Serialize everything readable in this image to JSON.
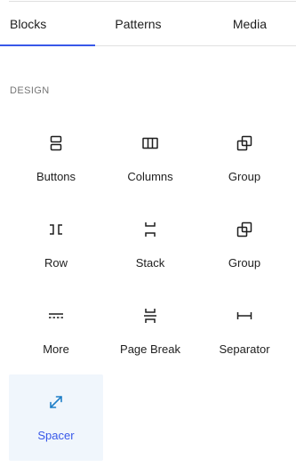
{
  "tabs": [
    {
      "label": "Blocks",
      "active": true
    },
    {
      "label": "Patterns",
      "active": false
    },
    {
      "label": "Media",
      "active": false
    }
  ],
  "section": {
    "title": "DESIGN"
  },
  "blocks": [
    {
      "label": "Buttons",
      "icon": "buttons-icon"
    },
    {
      "label": "Columns",
      "icon": "columns-icon"
    },
    {
      "label": "Group",
      "icon": "group-icon"
    },
    {
      "label": "Row",
      "icon": "row-icon"
    },
    {
      "label": "Stack",
      "icon": "stack-icon"
    },
    {
      "label": "Group",
      "icon": "group-icon"
    },
    {
      "label": "More",
      "icon": "more-icon"
    },
    {
      "label": "Page Break",
      "icon": "page-break-icon"
    },
    {
      "label": "Separator",
      "icon": "separator-icon"
    },
    {
      "label": "Spacer",
      "icon": "spacer-icon",
      "selected": true
    }
  ],
  "colors": {
    "accent": "#3858e9",
    "selected_background": "#f0f6fc",
    "text": "#1e1e1e",
    "muted": "#757575"
  }
}
